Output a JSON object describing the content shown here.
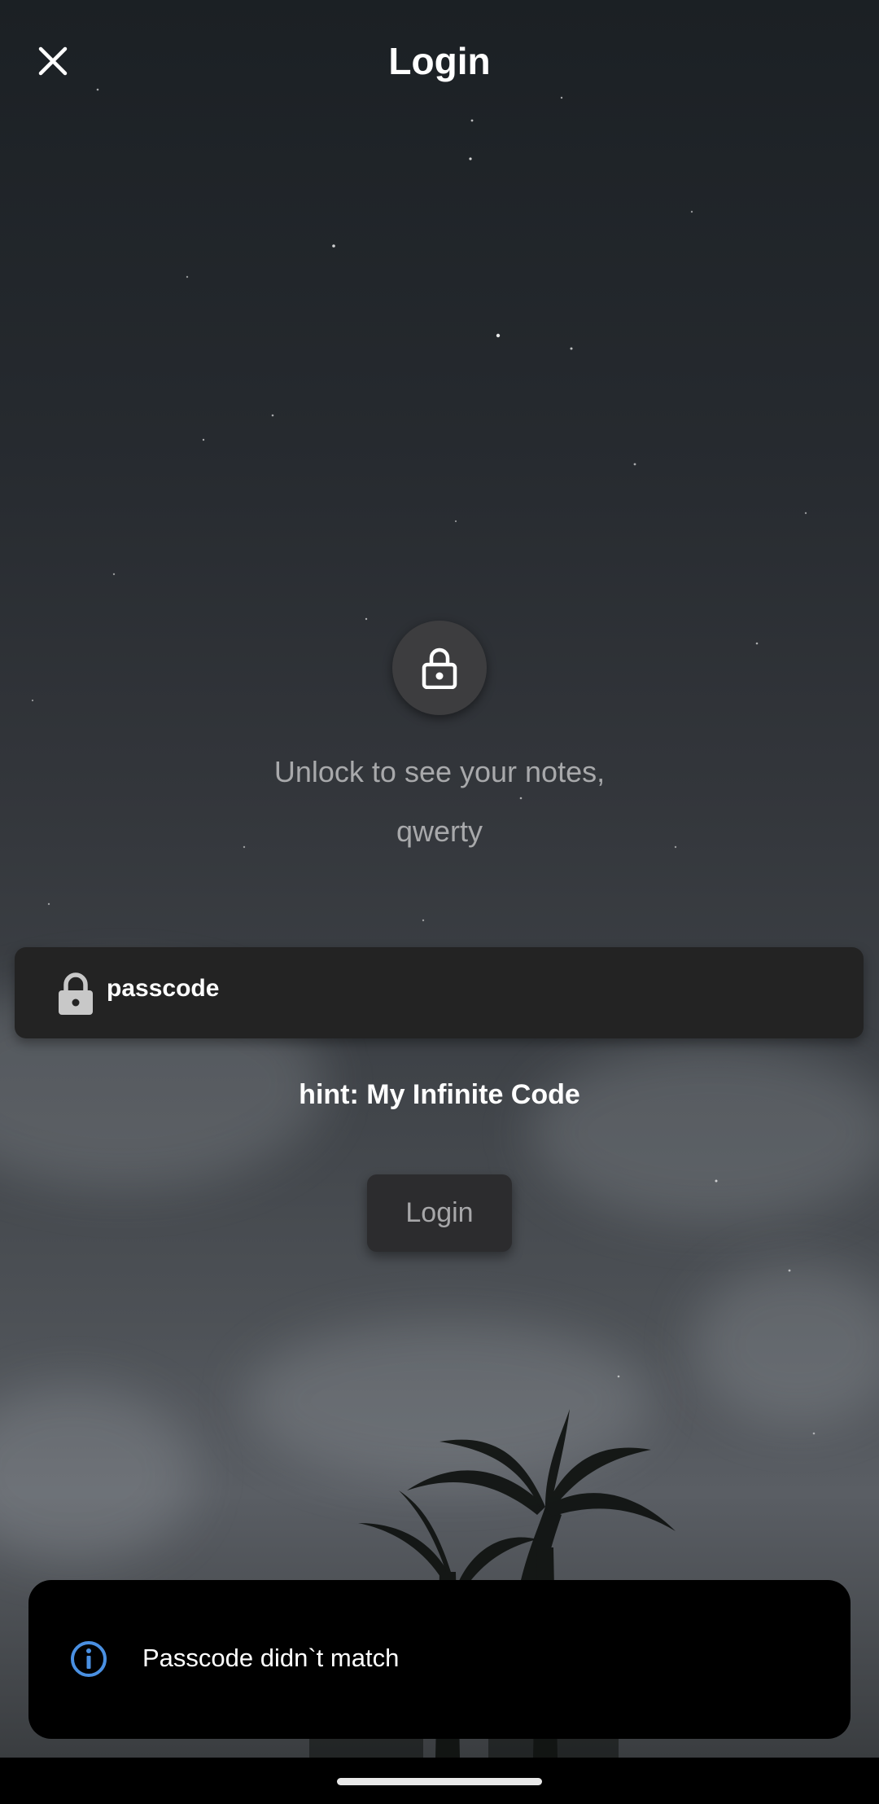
{
  "header": {
    "title": "Login",
    "close_icon": "close-icon"
  },
  "lock_badge": {
    "icon": "lock-icon"
  },
  "unlock_message": {
    "line1": "Unlock to see your notes,",
    "line2": "qwerty"
  },
  "passcode_field": {
    "value": "passcode",
    "icon": "lock-icon"
  },
  "hint": {
    "text": "hint: My Infinite Code"
  },
  "login_button": {
    "label": "Login"
  },
  "snackbar": {
    "icon": "info-icon",
    "message": "Passcode didn`t match"
  },
  "colors": {
    "snackbar_bg": "#000000",
    "info_icon": "#4a90e2",
    "input_bg": "#232323",
    "button_bg": "#2c2c2e"
  }
}
